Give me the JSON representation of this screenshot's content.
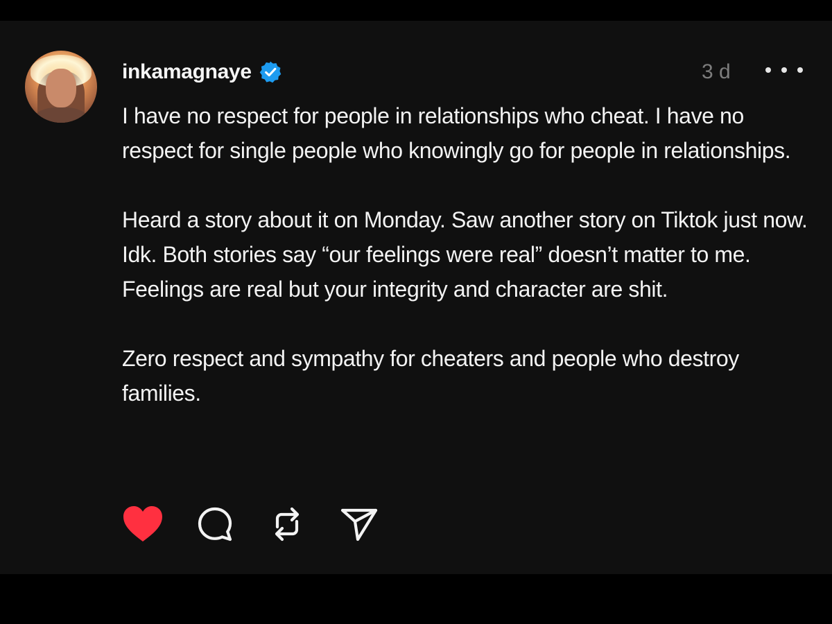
{
  "post": {
    "username": "inkamagnaye",
    "verified": true,
    "timestamp": "3 d",
    "paragraphs": [
      "I have no respect for people in relationships who cheat. I have no respect for single people who knowingly go for people in relationships.",
      "Heard a story about it on Monday. Saw another story on Tiktok just now. Idk. Both stories say “our feelings were real” doesn’t matter to me. Feelings are real but your integrity and character are shit.",
      "Zero respect and sympathy for cheaters and people who destroy families."
    ],
    "actions": {
      "like_icon": "heart-icon",
      "like_active": true,
      "comment_icon": "comment-icon",
      "repost_icon": "repost-icon",
      "share_icon": "send-icon"
    },
    "menu_icon": "more-options-icon"
  },
  "colors": {
    "background": "#101010",
    "outer_background": "#000000",
    "text": "#f3f3f3",
    "muted": "#7d7d7d",
    "verified_blue": "#1d9bf0",
    "like_red": "#ff3040"
  }
}
